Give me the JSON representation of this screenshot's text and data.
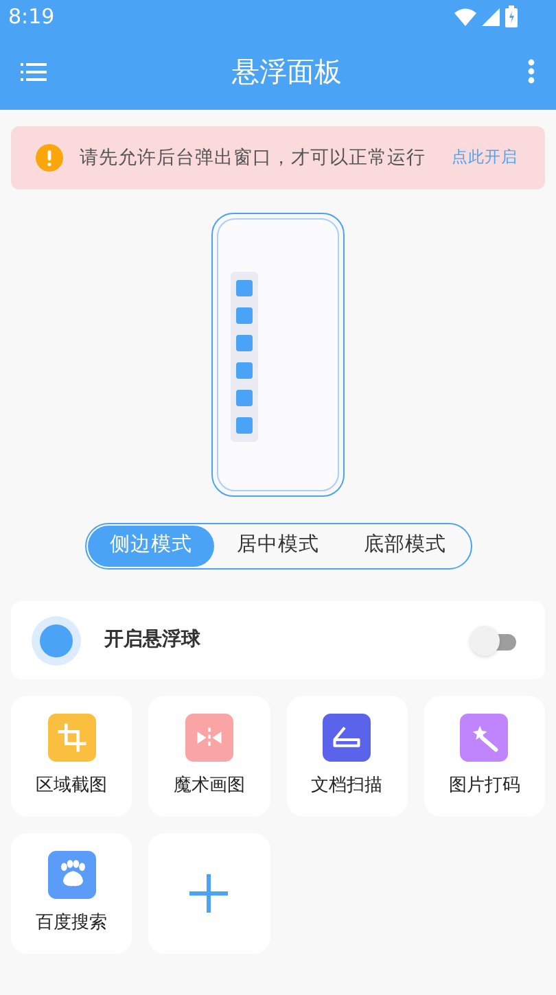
{
  "status_bar": {
    "time": "8:19"
  },
  "app_bar": {
    "title": "悬浮面板"
  },
  "banner": {
    "message": "请先允许后台弹出窗口，才可以正常运行",
    "action": "点此开启"
  },
  "modes": [
    {
      "label": "侧边模式",
      "selected": true
    },
    {
      "label": "居中模式",
      "selected": false
    },
    {
      "label": "底部模式",
      "selected": false
    }
  ],
  "float_ball": {
    "label": "开启悬浮球",
    "on": false
  },
  "tools": [
    {
      "kind": "tool",
      "label": "区域截图",
      "color": "#fbbf3f"
    },
    {
      "kind": "tool",
      "label": "魔术画图",
      "color": "#f9a5a5"
    },
    {
      "kind": "tool",
      "label": "文档扫描",
      "color": "#5b63ea"
    },
    {
      "kind": "tool",
      "label": "图片打码",
      "color": "#c084fc"
    },
    {
      "kind": "tool",
      "label": "百度搜索",
      "color": "#5b9cf8"
    },
    {
      "kind": "add"
    }
  ]
}
